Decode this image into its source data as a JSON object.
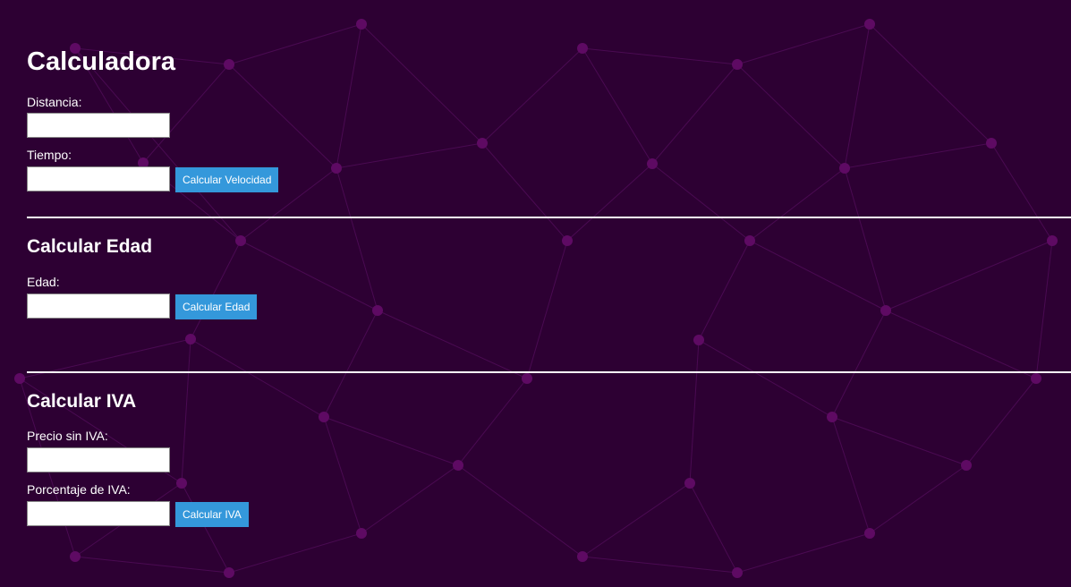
{
  "velocidad": {
    "title": "Calculadora",
    "distancia_label": "Distancia:",
    "distancia_value": "",
    "tiempo_label": "Tiempo:",
    "tiempo_value": "",
    "button_label": "Calcular Velocidad"
  },
  "edad": {
    "title": "Calcular Edad",
    "edad_label": "Edad:",
    "edad_value": "",
    "button_label": "Calcular Edad"
  },
  "iva": {
    "title": "Calcular IVA",
    "precio_label": "Precio sin IVA:",
    "precio_value": "",
    "porcentaje_label": "Porcentaje de IVA:",
    "porcentaje_value": "",
    "button_label": "Calcular IVA"
  },
  "theme": {
    "background": "#2d0033",
    "node_color": "#5e0a63",
    "button_color": "#3498db",
    "text_color": "#ffffff"
  }
}
